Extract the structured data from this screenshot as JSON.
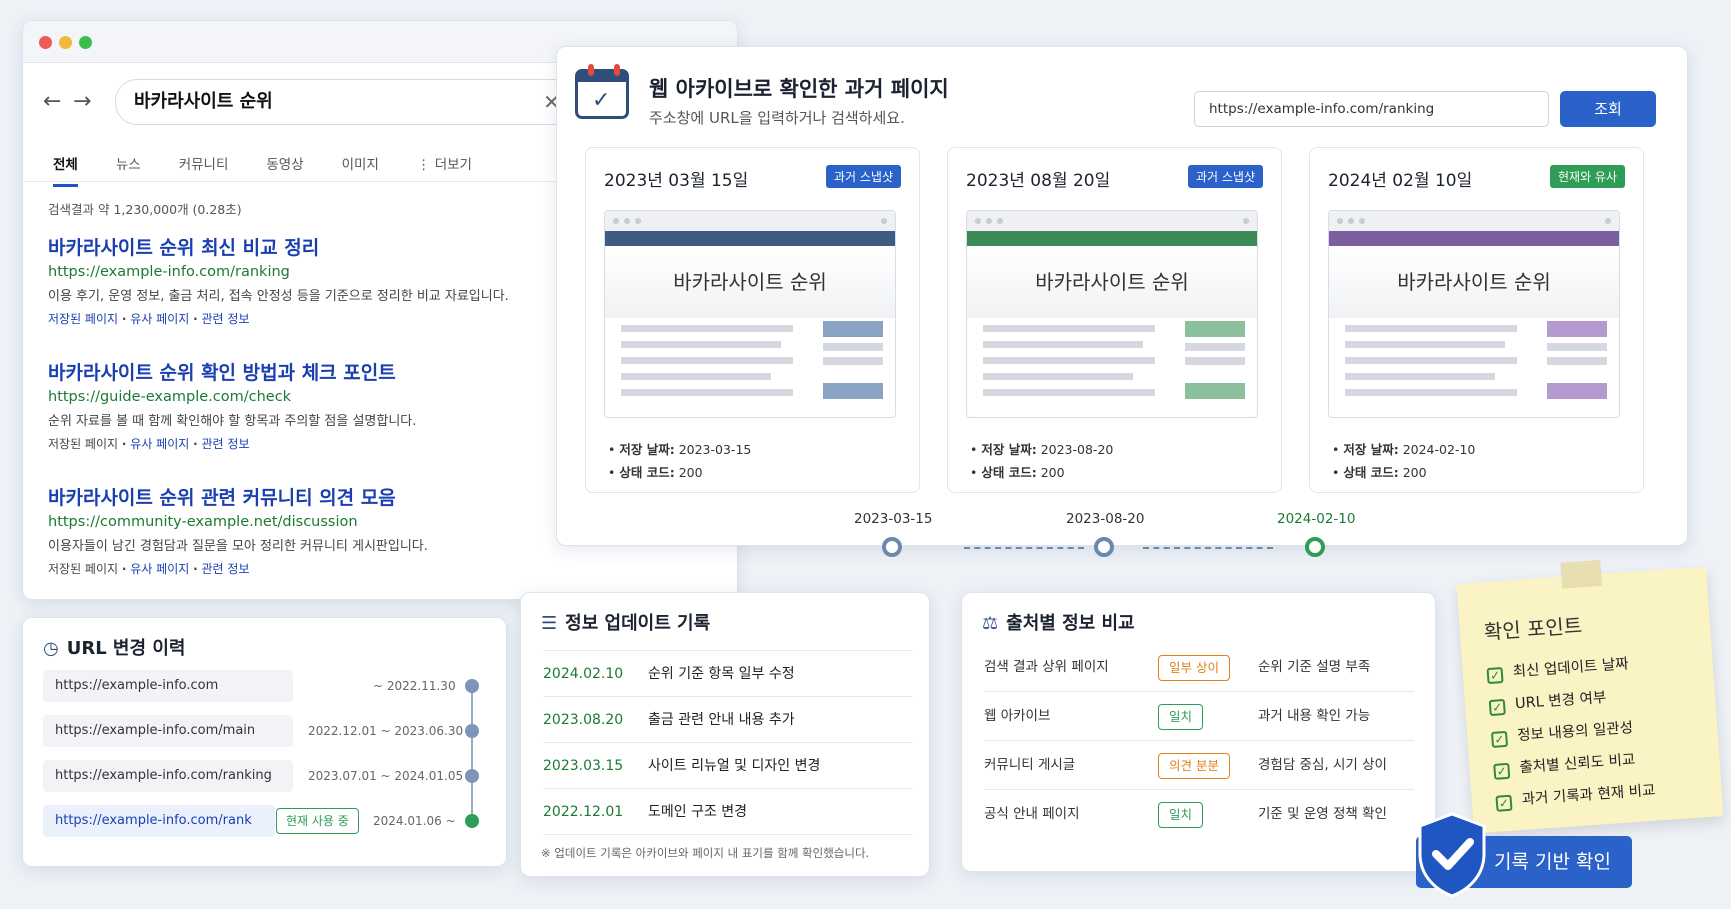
{
  "browser": {
    "search_query": "바카라사이트 순위",
    "tabs": [
      "전체",
      "뉴스",
      "커뮤니티",
      "동영상",
      "이미지",
      "더보기"
    ],
    "result_count": "검색결과 약 1,230,000개 (0.28초)",
    "results": [
      {
        "title": "바카라사이트 순위 최신 비교 정리",
        "url": "https://example-info.com/ranking",
        "desc": "이용 후기, 운영 정보, 출금 처리, 접속 안정성 등을 기준으로 정리한 비교 자료입니다."
      },
      {
        "title": "바카라사이트 순위 확인 방법과 체크 포인트",
        "url": "https://guide-example.com/check",
        "desc": "순위 자료를 볼 때 함께 확인해야 할 항목과 주의할 점을 설명합니다."
      },
      {
        "title": "바카라사이트 순위 관련 커뮤니티 의견 모음",
        "url": "https://community-example.net/discussion",
        "desc": "이용자들이 남긴 경험담과 질문을 모아 정리한 커뮤니티 게시판입니다."
      }
    ],
    "links": {
      "saved": "저장된 페이지",
      "similar": "유사 페이지",
      "related": "관련 정보",
      "sep": "·"
    }
  },
  "archive": {
    "title": "웹 아카이브로 확인한 과거 페이지",
    "subtitle": "주소창에 URL을 입력하거나 검색하세요.",
    "url_value": "https://example-info.com/ranking",
    "lookup_button": "조회",
    "snapshots": [
      {
        "date": "2023년 03월 15일",
        "badge": "과거 스냅샷",
        "badge_color": "#2a62c9",
        "accent": "#3e5b84",
        "side": "#8aa3c2",
        "page_title": "바카라사이트 순위",
        "saved_date_label": "저장 날짜:",
        "saved_date": "2023-03-15",
        "status_label": "상태 코드:",
        "status": "200"
      },
      {
        "date": "2023년 08월 20일",
        "badge": "과거 스냅샷",
        "badge_color": "#2a62c9",
        "accent": "#3c8a55",
        "side": "#8cc09c",
        "page_title": "바카라사이트 순위",
        "saved_date_label": "저장 날짜:",
        "saved_date": "2023-08-20",
        "status_label": "상태 코드:",
        "status": "200"
      },
      {
        "date": "2024년 02월 10일",
        "badge": "현재와 유사",
        "badge_color": "#2e9d55",
        "accent": "#7b5f9e",
        "side": "#b39bd0",
        "page_title": "바카라사이트 순위",
        "saved_date_label": "저장 날짜:",
        "saved_date": "2024-02-10",
        "status_label": "상태 코드:",
        "status": "200"
      }
    ],
    "timeline": [
      "2023-03-15",
      "2023-08-20",
      "2024-02-10"
    ]
  },
  "url_history": {
    "title": "URL 변경 이력",
    "rows": [
      {
        "url": "https://example-info.com",
        "period": "~ 2022.11.30"
      },
      {
        "url": "https://example-info.com/main",
        "period": "2022.12.01 ~ 2023.06.30"
      },
      {
        "url": "https://example-info.com/ranking",
        "period": "2023.07.01 ~ 2024.01.05"
      },
      {
        "url": "https://example-info.com/rank",
        "period": "2024.01.06 ~",
        "current_badge": "현재 사용 중"
      }
    ]
  },
  "updates": {
    "title": "정보 업데이트 기록",
    "rows": [
      {
        "date": "2024.02.10",
        "text": "순위 기준 항목 일부 수정"
      },
      {
        "date": "2023.08.20",
        "text": "출금 관련 안내 내용 추가"
      },
      {
        "date": "2023.03.15",
        "text": "사이트 리뉴얼 및 디자인 변경"
      },
      {
        "date": "2022.12.01",
        "text": "도메인 구조 변경"
      }
    ],
    "note": "※ 업데이트 기록은 아카이브와 페이지 내 표기를 함께 확인했습니다."
  },
  "sources": {
    "title": "출처별 정보 비교",
    "rows": [
      {
        "source": "검색 결과 상위 페이지",
        "status": "일부 상이",
        "color": "#e0821c",
        "note": "순위 기준 설명 부족"
      },
      {
        "source": "웹 아카이브",
        "status": "일치",
        "color": "#2e9d55",
        "note": "과거 내용 확인 가능"
      },
      {
        "source": "커뮤니티 게시글",
        "status": "의견 분분",
        "color": "#e0821c",
        "note": "경험담 중심, 시기 상이"
      },
      {
        "source": "공식 안내 페이지",
        "status": "일치",
        "color": "#2e9d55",
        "note": "기준 및 운영 정책 확인"
      }
    ]
  },
  "sticky": {
    "title": "확인 포인트",
    "items": [
      "최신 업데이트 날짜",
      "URL 변경 여부",
      "정보 내용의 일관성",
      "출처별 신뢰도 비교",
      "과거 기록과 현재 비교"
    ]
  },
  "record_button": "기록 기반 확인"
}
